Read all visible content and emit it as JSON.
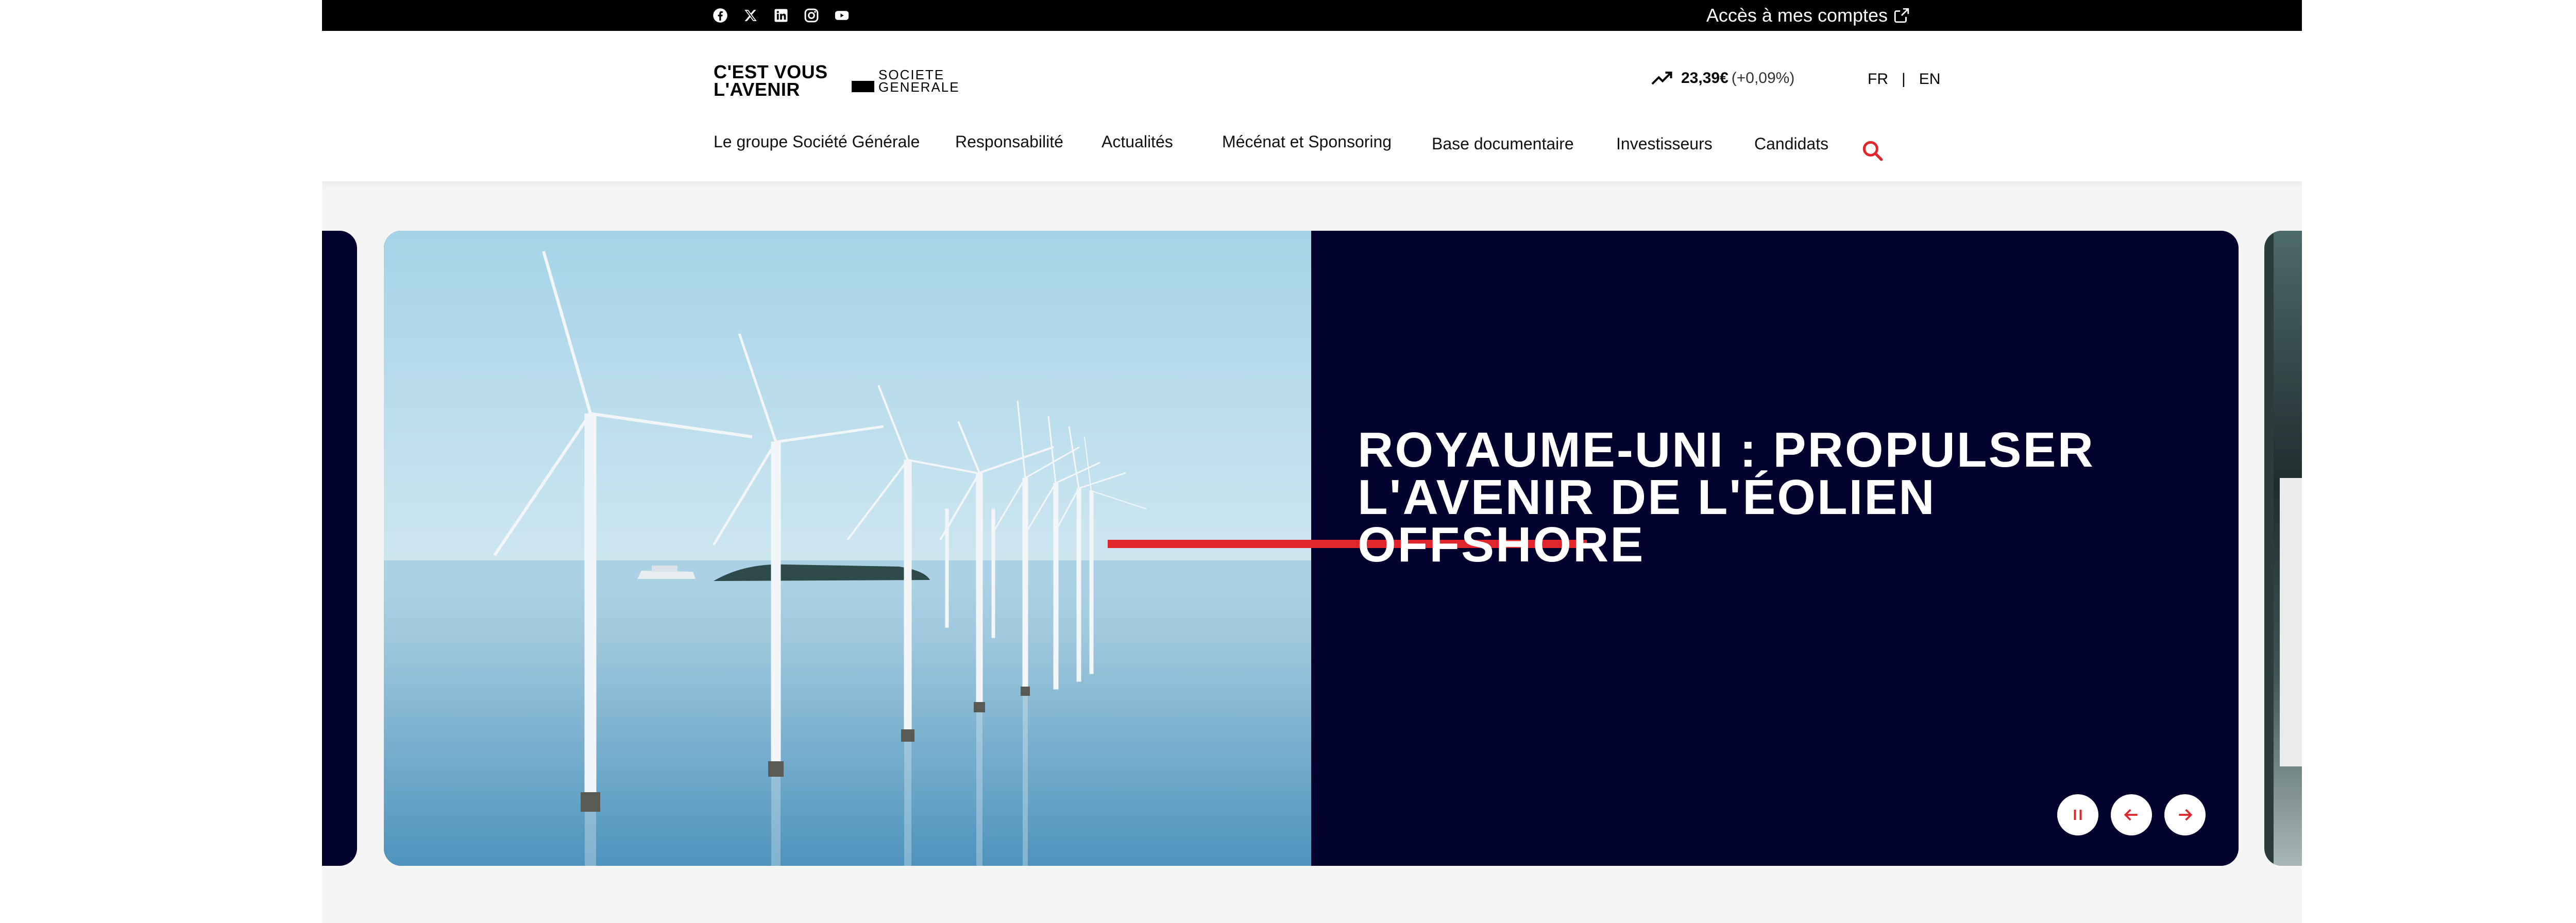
{
  "topbar": {
    "social": [
      {
        "name": "facebook-icon"
      },
      {
        "name": "x-twitter-icon"
      },
      {
        "name": "linkedin-icon"
      },
      {
        "name": "instagram-icon"
      },
      {
        "name": "youtube-icon"
      }
    ],
    "accounts_label": "Accès à mes comptes",
    "accounts_icon": "external-link-icon"
  },
  "header": {
    "logo": {
      "slogan_line1": "C'EST VOUS",
      "slogan_line2": "L'AVENIR",
      "brand_line1": "SOCIETE",
      "brand_line2": "GENERALE"
    },
    "stock": {
      "icon": "trending-up-icon",
      "price": "23,39€",
      "change": "(+0,09%)"
    },
    "languages": [
      "FR",
      "EN"
    ],
    "language_separator": "|",
    "nav": [
      "Le groupe Société Générale",
      "Responsabilité",
      "Actualités",
      "Mécénat et Sponsoring",
      "Base documentaire",
      "Investisseurs",
      "Candidats"
    ],
    "search_icon": "search-icon"
  },
  "carousel": {
    "title_line1": "ROYAUME-UNI : PROPULSER",
    "title_line2": "L'AVENIR DE L'ÉOLIEN OFFSHORE",
    "controls": [
      "pause-icon",
      "arrow-left-icon",
      "arrow-right-icon"
    ],
    "colors": {
      "panel": "#01012e",
      "accent": "#e0262c"
    }
  }
}
